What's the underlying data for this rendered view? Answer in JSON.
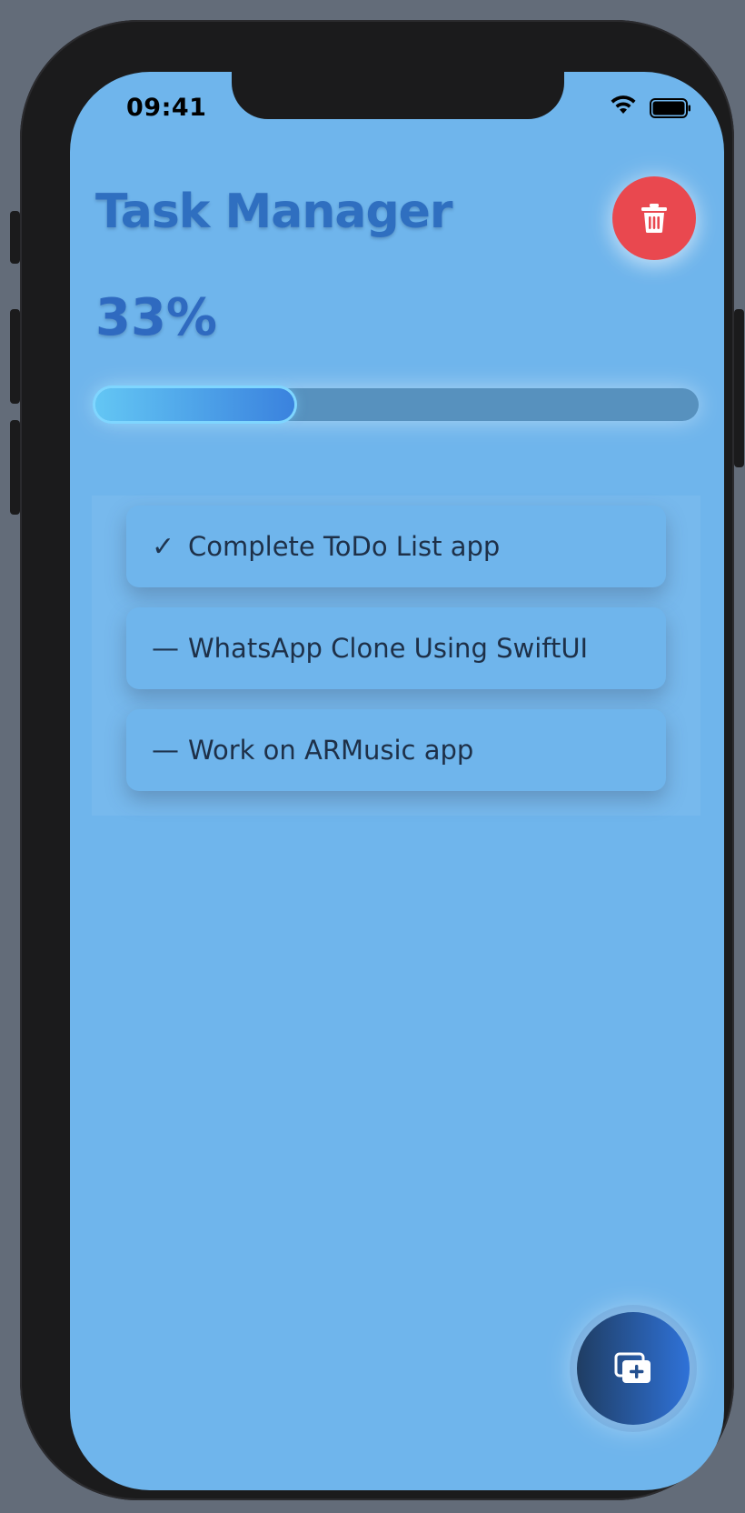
{
  "status_bar": {
    "time": "09:41"
  },
  "header": {
    "title": "Task Manager"
  },
  "progress": {
    "percent_label": "33%",
    "value": 0.33
  },
  "tasks": [
    {
      "mark": "✓",
      "label": "Complete ToDo List app",
      "completed": true
    },
    {
      "mark": "—",
      "label": "WhatsApp Clone Using SwiftUI",
      "completed": false
    },
    {
      "mark": "—",
      "label": "Work on ARMusic app",
      "completed": false
    }
  ],
  "icons": {
    "delete": "trash-icon",
    "add": "add-task-icon",
    "wifi": "wifi-icon",
    "battery": "battery-icon"
  },
  "colors": {
    "background": "#6fb5ec",
    "title": "#2f6fc0",
    "delete_button": "#e9484f",
    "progress_track": "#5791be",
    "progress_fill_start": "#63c6f4",
    "progress_fill_end": "#3a82de",
    "add_button_start": "#1f3d63",
    "add_button_end": "#2f72d8"
  }
}
